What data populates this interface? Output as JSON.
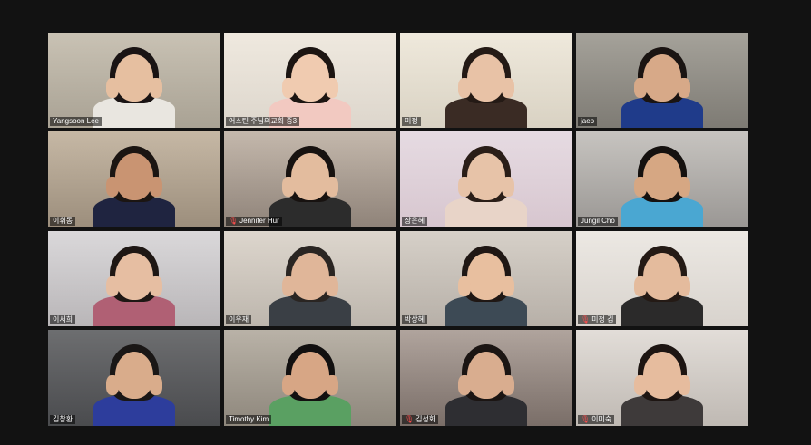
{
  "participants": [
    {
      "name": "Yangsoon Lee",
      "muted": false,
      "bg": "#a9a294",
      "wall": "#c9c2b4",
      "skin": "#e6bfa0",
      "hair": "#1a1414",
      "shirt": "#e9e6e0",
      "active": false
    },
    {
      "name": "어스틴 주님의교회 중3",
      "muted": false,
      "bg": "#ddd6cc",
      "wall": "#efe9df",
      "skin": "#f0cbb0",
      "hair": "#1c1512",
      "shirt": "#f2c9c1",
      "active": false
    },
    {
      "name": "미정",
      "muted": false,
      "bg": "#d9d2c3",
      "wall": "#efe9dc",
      "skin": "#e8c2a6",
      "hair": "#241a15",
      "shirt": "#3a2b24",
      "active": true
    },
    {
      "name": "jaep",
      "muted": false,
      "bg": "#7e7b74",
      "wall": "#a5a29a",
      "skin": "#d7a988",
      "hair": "#1a1412",
      "shirt": "#1f3b8a",
      "active": false
    },
    {
      "name": "이휘동",
      "muted": false,
      "bg": "#9c8e7c",
      "wall": "#c6b8a5",
      "skin": "#c99472",
      "hair": "#1b1512",
      "shirt": "#1f2440",
      "active": false
    },
    {
      "name": "Jennifer Hur",
      "muted": true,
      "bg": "#8f8379",
      "wall": "#c4b8ac",
      "skin": "#e3bc9e",
      "hair": "#171210",
      "shirt": "#2c2c2c",
      "active": false
    },
    {
      "name": "장은혜",
      "muted": false,
      "bg": "#d7c6cf",
      "wall": "#e6dbe2",
      "skin": "#e7c3a8",
      "hair": "#2a1e18",
      "shirt": "#e8d4c8",
      "active": false
    },
    {
      "name": "Jungil Cho",
      "muted": false,
      "bg": "#9a9794",
      "wall": "#c7c4c0",
      "skin": "#d6a783",
      "hair": "#15110f",
      "shirt": "#4aa7d2",
      "active": false
    },
    {
      "name": "이서희",
      "muted": false,
      "bg": "#b9b6b8",
      "wall": "#dad8da",
      "skin": "#e6bea2",
      "hair": "#1e1714",
      "shirt": "#b06074",
      "active": false
    },
    {
      "name": "이우재",
      "muted": false,
      "bg": "#bdb6ad",
      "wall": "#ddd6cd",
      "skin": "#e0b699",
      "hair": "#2a2522",
      "shirt": "#3a3f45",
      "active": false
    },
    {
      "name": "박상혜",
      "muted": false,
      "bg": "#b7b0a8",
      "wall": "#d6d0c8",
      "skin": "#e8bf9f",
      "hair": "#1f1714",
      "shirt": "#3d4a55",
      "active": false
    },
    {
      "name": "미정 김",
      "muted": true,
      "bg": "#d8d3cd",
      "wall": "#ece8e3",
      "skin": "#e4bb9d",
      "hair": "#241a15",
      "shirt": "#2b2a2a",
      "active": false
    },
    {
      "name": "김창환",
      "muted": false,
      "bg": "#4a4b4e",
      "wall": "#6d6e70",
      "skin": "#d9ac8b",
      "hair": "#1a1716",
      "shirt": "#2d3d9c",
      "active": false
    },
    {
      "name": "Timothy Kim",
      "muted": false,
      "bg": "#8e877c",
      "wall": "#b9b2a7",
      "skin": "#d7a685",
      "hair": "#121010",
      "shirt": "#5aa062",
      "active": false
    },
    {
      "name": "김성화",
      "muted": true,
      "bg": "#7a6e68",
      "wall": "#b0a49d",
      "skin": "#d9ad8f",
      "hair": "#1b1513",
      "shirt": "#2e2e32",
      "active": false
    },
    {
      "name": "이미숙",
      "muted": true,
      "bg": "#bfb9b3",
      "wall": "#e2ddd8",
      "skin": "#e6bc9e",
      "hair": "#1d1512",
      "shirt": "#3e3a3a",
      "active": false
    }
  ]
}
